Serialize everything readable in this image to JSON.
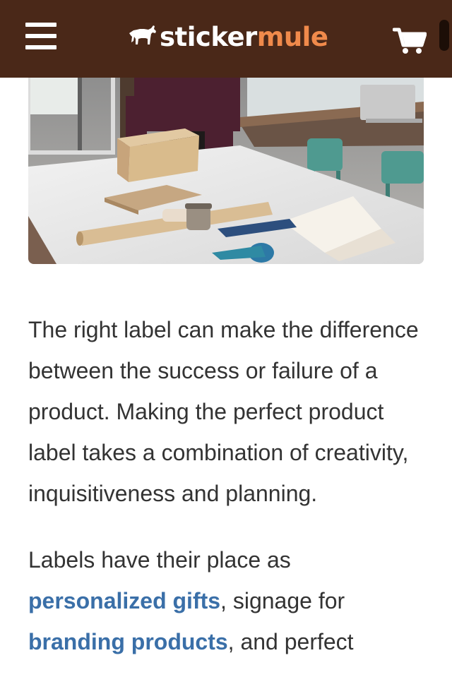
{
  "header": {
    "brand_part1": "sticker",
    "brand_part2": "mule",
    "menu_icon": "hamburger-menu-icon",
    "cart_icon": "shopping-cart-icon",
    "colors": {
      "bar": "#4a2818",
      "brand_accent": "#f08a4b"
    }
  },
  "hero": {
    "icon": "photo"
  },
  "article": {
    "paragraph1": "The right label can make the difference between the success or failure of a product. Making the perfect product label takes a combination of creativity, inquisitiveness and planning.",
    "paragraph2_start": "Labels have their place as ",
    "link1": "personalized gifts",
    "paragraph2_mid": ", signage for ",
    "link2": "branding products",
    "paragraph2_end": ", and perfect"
  },
  "colors": {
    "text": "#333333",
    "link": "#3a6fa8"
  }
}
